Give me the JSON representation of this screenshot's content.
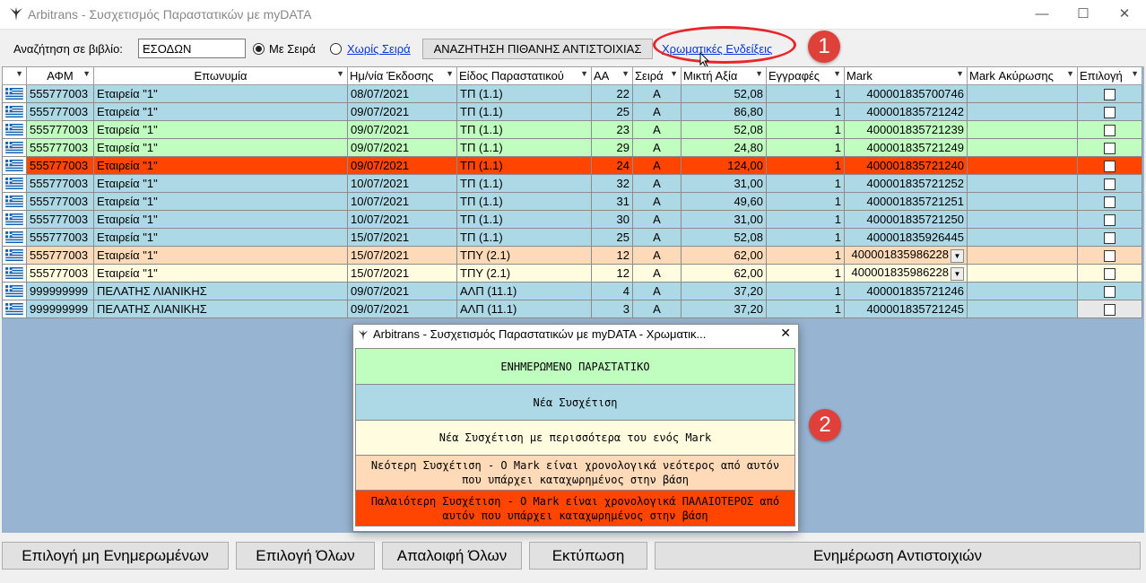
{
  "window": {
    "title": "Arbitrans - Συσχετισμός Παραστατικών με myDATA",
    "minimize": "—",
    "maximize": "☐",
    "close": "✕"
  },
  "toolbar": {
    "search_label": "Αναζήτηση σε βιβλίο:",
    "book_value": "ΕΣΟΔΩΝ",
    "radio_with_series": "Με Σειρά",
    "radio_without_series": "Χωρίς Σειρά",
    "search_button": "ΑΝΑΖΗΤΗΣΗ ΠΙΘΑΝΗΣ ΑΝΤΙΣΤΟΙΧΙΑΣ",
    "color_link": "Χρωματικές Ενδείξεις"
  },
  "annotations": {
    "badge1": "1",
    "badge2": "2"
  },
  "colors": {
    "blue": "#add8e6",
    "green": "#c0fec0",
    "red": "#ff4500",
    "orange": "#ffdab9",
    "yellow": "#fffce0",
    "grid_bg": "#97b4d2"
  },
  "grid": {
    "columns": [
      "",
      "ΑΦΜ",
      "Επωνυμία",
      "Ημ/νία Έκδοσης",
      "Είδος Παραστατικού",
      "ΑΑ",
      "Σειρά",
      "Μικτή Αξία",
      "Εγγραφές",
      "Mark",
      "Mark Ακύρωσης",
      "Επιλογή"
    ],
    "rows": [
      {
        "afm": "555777003",
        "name": "Εταιρεία \"1\"",
        "date": "08/07/2021",
        "type": "ΤΠ (1.1)",
        "aa": "22",
        "series": "A",
        "amount": "52,08",
        "entries": "1",
        "mark": "400001835700746",
        "color": "blue"
      },
      {
        "afm": "555777003",
        "name": "Εταιρεία \"1\"",
        "date": "09/07/2021",
        "type": "ΤΠ (1.1)",
        "aa": "25",
        "series": "A",
        "amount": "86,80",
        "entries": "1",
        "mark": "400001835721242",
        "color": "blue"
      },
      {
        "afm": "555777003",
        "name": "Εταιρεία \"1\"",
        "date": "09/07/2021",
        "type": "ΤΠ (1.1)",
        "aa": "23",
        "series": "A",
        "amount": "52,08",
        "entries": "1",
        "mark": "400001835721239",
        "color": "green"
      },
      {
        "afm": "555777003",
        "name": "Εταιρεία \"1\"",
        "date": "09/07/2021",
        "type": "ΤΠ (1.1)",
        "aa": "29",
        "series": "A",
        "amount": "24,80",
        "entries": "1",
        "mark": "400001835721249",
        "color": "green"
      },
      {
        "afm": "555777003",
        "name": "Εταιρεία \"1\"",
        "date": "09/07/2021",
        "type": "ΤΠ (1.1)",
        "aa": "24",
        "series": "A",
        "amount": "124,00",
        "entries": "1",
        "mark": "400001835721240",
        "color": "red"
      },
      {
        "afm": "555777003",
        "name": "Εταιρεία \"1\"",
        "date": "10/07/2021",
        "type": "ΤΠ (1.1)",
        "aa": "32",
        "series": "A",
        "amount": "31,00",
        "entries": "1",
        "mark": "400001835721252",
        "color": "blue"
      },
      {
        "afm": "555777003",
        "name": "Εταιρεία \"1\"",
        "date": "10/07/2021",
        "type": "ΤΠ (1.1)",
        "aa": "31",
        "series": "A",
        "amount": "49,60",
        "entries": "1",
        "mark": "400001835721251",
        "color": "blue"
      },
      {
        "afm": "555777003",
        "name": "Εταιρεία \"1\"",
        "date": "10/07/2021",
        "type": "ΤΠ (1.1)",
        "aa": "30",
        "series": "A",
        "amount": "31,00",
        "entries": "1",
        "mark": "400001835721250",
        "color": "blue"
      },
      {
        "afm": "555777003",
        "name": "Εταιρεία \"1\"",
        "date": "15/07/2021",
        "type": "ΤΠ (1.1)",
        "aa": "25",
        "series": "A",
        "amount": "52,08",
        "entries": "1",
        "mark": "400001835926445",
        "color": "blue"
      },
      {
        "afm": "555777003",
        "name": "Εταιρεία \"1\"",
        "date": "15/07/2021",
        "type": "ΤΠΥ (2.1)",
        "aa": "12",
        "series": "A",
        "amount": "62,00",
        "entries": "1",
        "mark": "400001835986228",
        "color": "orange",
        "has_dropdown": true
      },
      {
        "afm": "555777003",
        "name": "Εταιρεία \"1\"",
        "date": "15/07/2021",
        "type": "ΤΠΥ (2.1)",
        "aa": "12",
        "series": "A",
        "amount": "62,00",
        "entries": "1",
        "mark": "400001835986228",
        "color": "yellow",
        "has_dropdown": true
      },
      {
        "afm": "999999999",
        "name": "ΠΕΛΑΤΗΣ ΛΙΑΝΙΚΗΣ",
        "date": "09/07/2021",
        "type": "ΑΛΠ (11.1)",
        "aa": "4",
        "series": "A",
        "amount": "37,20",
        "entries": "1",
        "mark": "400001835721246",
        "color": "blue"
      },
      {
        "afm": "999999999",
        "name": "ΠΕΛΑΤΗΣ ΛΙΑΝΙΚΗΣ",
        "date": "09/07/2021",
        "type": "ΑΛΠ (11.1)",
        "aa": "3",
        "series": "A",
        "amount": "37,20",
        "entries": "1",
        "mark": "400001835721245",
        "color": "blue"
      }
    ]
  },
  "legend": {
    "title": "Arbitrans - Συσχετισμός Παραστατικών με myDATA - Χρωματικ...",
    "close": "✕",
    "items": [
      {
        "text": "ΕΝΗΜΕΡΩΜΕΝΟ ΠΑΡΑΣΤΑΤΙΚΟ",
        "color": "#c0fec0"
      },
      {
        "text": "Νέα Συσχέτιση",
        "color": "#add8e6"
      },
      {
        "text": "Νέα Συσχέτιση με περισσότερα του ενός Mark",
        "color": "#fffce0"
      },
      {
        "text": "Νεότερη Συσχέτιση - Ο Mark είναι χρονολογικά νεότερος από αυτόν που υπάρχει καταχωρημένος στην βάση",
        "color": "#ffdab9"
      },
      {
        "text": "Παλαιότερη Συσχέτιση - Ο Mark είναι χρονολογικά ΠΑΛΑΙΟΤΕΡΟΣ από αυτόν που υπάρχει καταχωρημένος στην βάση",
        "color": "#ff4500"
      }
    ]
  },
  "bottom": {
    "select_unupdated": "Επιλογή μη Ενημερωμένων",
    "select_all": "Επιλογή Όλων",
    "deselect_all": "Απαλοιφή Όλων",
    "print": "Εκτύπωση",
    "update": "Ενημέρωση Αντιστοιχιών"
  }
}
